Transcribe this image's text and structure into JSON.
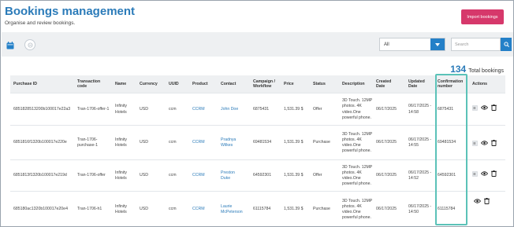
{
  "header": {
    "title": "Bookings management",
    "subtitle": "Organise and review bookings.",
    "import_label": "Import bookings"
  },
  "toolbar": {
    "filter_value": "All",
    "search_placeholder": "Search"
  },
  "summary": {
    "total_count": "134",
    "total_label": "Total bookings"
  },
  "table": {
    "columns": [
      "Purchase ID",
      "Transaction code",
      "Name",
      "Currency",
      "UUID",
      "Product",
      "Contact",
      "Campaign / Workflow",
      "Price",
      "Status",
      "Description",
      "Created Date",
      "Updated Date",
      "Confirmation number",
      "Actions"
    ],
    "rows": [
      {
        "purchase_id": "6851828513200b100017e22a3",
        "transaction_code": "Tran-1706-offer-1",
        "name": "Infinity Hotels",
        "currency": "USD",
        "uuid": "ccm",
        "product": "CCRM",
        "contact": "John Doe",
        "campaign": "6875431",
        "price": "1,531.39 $",
        "status": "Offer",
        "description": "3D Touch. 12MP photos. 4K video.One powerful phone.",
        "created": "06/17/2025",
        "updated": "06/17/2025 - 14:58",
        "confirmation": "6875431"
      },
      {
        "purchase_id": "6851816f1320b100017e220e",
        "transaction_code": "Tran-1706-purchase-1",
        "name": "Infinity Hotels",
        "currency": "USD",
        "uuid": "ccm",
        "product": "CCRM",
        "contact": "Pradnya Wilkes",
        "campaign": "69481534",
        "price": "1,531.39 $",
        "status": "Purchase",
        "description": "3D Touch. 12MP photos. 4K video.One powerful phone.",
        "created": "06/17/2025",
        "updated": "06/17/2025 - 14:55",
        "confirmation": "69481534"
      },
      {
        "purchase_id": "6851813f1320b100017e219d",
        "transaction_code": "Tran-1706-offer",
        "name": "Infinity Hotels",
        "currency": "USD",
        "uuid": "ccm",
        "product": "CCRM",
        "contact": "Preston Duke",
        "campaign": "64592301",
        "price": "1,531.39 $",
        "status": "Offer",
        "description": "3D Touch. 12MP photos. 4K video.One powerful phone.",
        "created": "06/17/2025",
        "updated": "06/17/2025 - 14:52",
        "confirmation": "64592301"
      },
      {
        "purchase_id": "685180ac1320b100017e20e4",
        "transaction_code": "Tran-1706-h1",
        "name": "Infinity Hotels",
        "currency": "USD",
        "uuid": "ccm",
        "product": "CCRM",
        "contact": "Laurie McPeterson",
        "campaign": "61115784",
        "price": "1,531.39 $",
        "status": "Purchase",
        "description": "3D Touch. 12MP photos. 4K video.One powerful phone.",
        "created": "06/17/2025",
        "updated": "06/17/2025 - 14:50",
        "confirmation": "61115784"
      }
    ]
  },
  "colors": {
    "brand_blue": "#2b7bb9",
    "import_pink": "#d6386b",
    "highlight_teal": "#5bc2b8"
  }
}
